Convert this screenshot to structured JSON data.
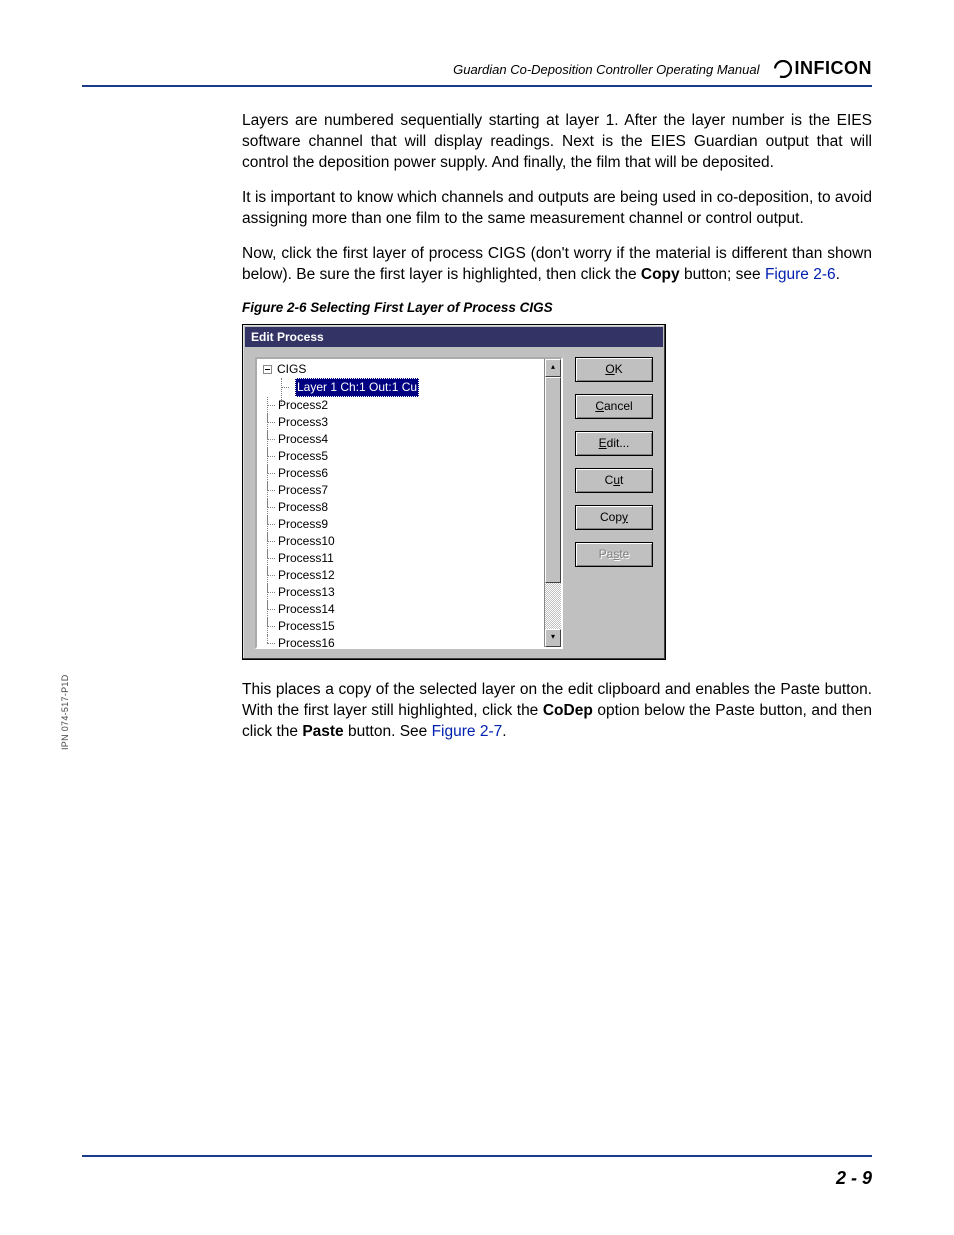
{
  "header": {
    "manual_title": "Guardian Co-Deposition Controller Operating Manual",
    "brand": "INFICON"
  },
  "paragraphs": {
    "p1": "Layers are numbered sequentially starting at layer 1. After the layer number is the EIES software channel that will display readings. Next is the EIES Guardian output that will control the deposition power supply. And finally, the film that will be deposited.",
    "p2": "It is important to know which channels and outputs are being used in co-deposition, to avoid assigning more than one film to the same measurement channel or control output.",
    "p3a": "Now, click the first layer of process CIGS (don't worry if the material is different than shown below). Be sure the first layer is highlighted, then click the ",
    "p3_bold": "Copy",
    "p3b": " button; see ",
    "p3_link": "Figure 2-6",
    "p3c": ".",
    "fig_caption": "Figure 2-6  Selecting First Layer of Process CIGS",
    "p4a": "This places a copy of the selected layer on the edit clipboard and enables the Paste button. With the first layer still highlighted, click the ",
    "p4_bold1": "CoDep",
    "p4b": " option below the Paste button, and then click the ",
    "p4_bold2": "Paste",
    "p4c": " button. See ",
    "p4_link": "Figure 2-7",
    "p4d": "."
  },
  "dialog": {
    "title": "Edit Process",
    "tree": {
      "root": "CIGS",
      "selected": "Layer 1 Ch:1 Out:1 Cu",
      "items": [
        "Process2",
        "Process3",
        "Process4",
        "Process5",
        "Process6",
        "Process7",
        "Process8",
        "Process9",
        "Process10",
        "Process11",
        "Process12",
        "Process13",
        "Process14",
        "Process15",
        "Process16"
      ]
    },
    "buttons": {
      "ok_u": "O",
      "ok": "K",
      "cancel_u": "C",
      "cancel": "ancel",
      "edit_u": "E",
      "edit": "dit...",
      "cut_pre": "C",
      "cut_u": "u",
      "cut_post": "t",
      "copy_pre": "Cop",
      "copy_u": "y",
      "copy_post": "",
      "paste_pre": "Pa",
      "paste_u": "s",
      "paste_post": "te"
    }
  },
  "side_text": "IPN 074-517-P1D",
  "page_number": "2 - 9"
}
